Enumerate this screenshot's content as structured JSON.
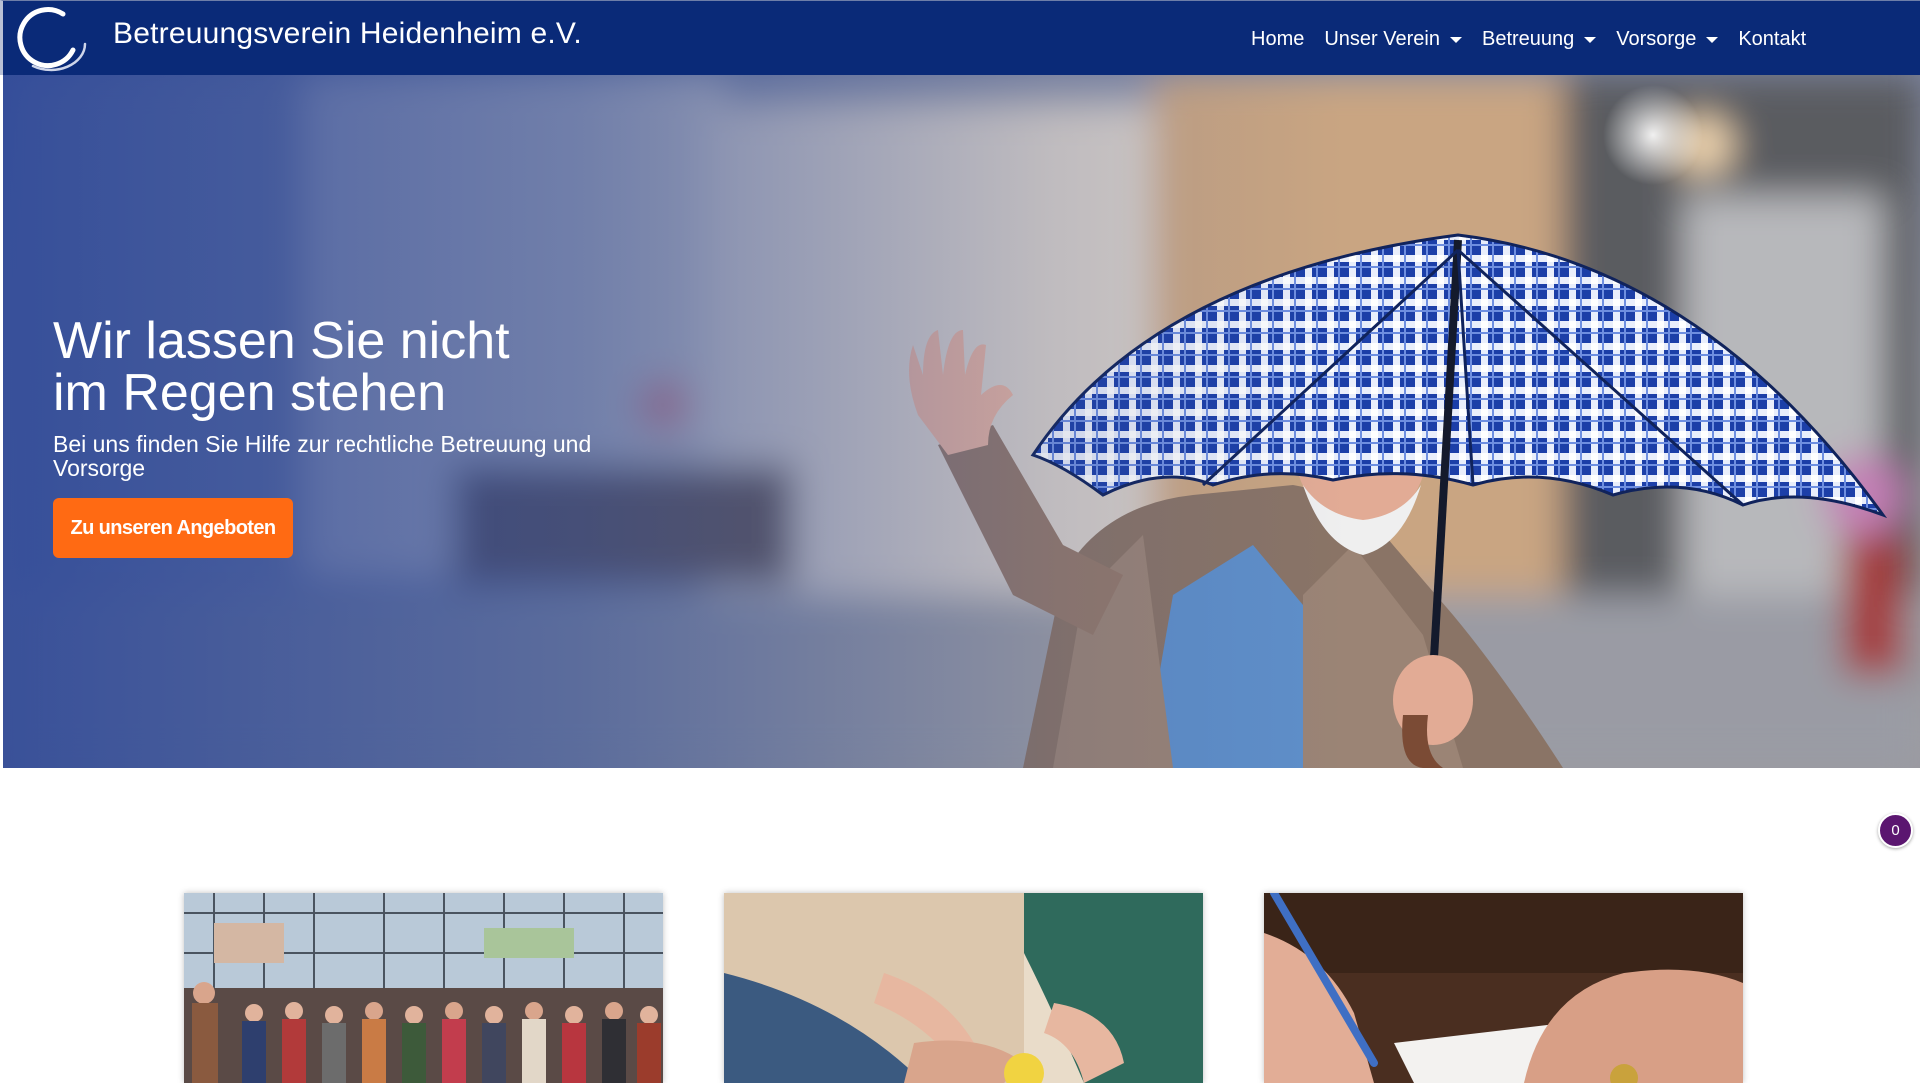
{
  "brand": {
    "name": "Betreuungsverein Heidenheim e.V.",
    "logo_icon": "crescent-ring-logo"
  },
  "nav": {
    "items": [
      {
        "label": "Home",
        "dropdown": false
      },
      {
        "label": "Unser Verein",
        "dropdown": true
      },
      {
        "label": "Betreuung",
        "dropdown": true
      },
      {
        "label": "Vorsorge",
        "dropdown": true
      },
      {
        "label": "Kontakt",
        "dropdown": false
      }
    ]
  },
  "hero": {
    "title_line1": "Wir lassen Sie nicht",
    "title_line2": "im Regen stehen",
    "subtitle": "Bei uns finden Sie Hilfe zur rechtliche Betreuung und Vorsorge",
    "cta_label": "Zu unseren Angeboten"
  },
  "badge": {
    "count": "0"
  },
  "colors": {
    "navbar": "#0a2a78",
    "cta": "#ff6a13",
    "badge": "#5b1670"
  }
}
